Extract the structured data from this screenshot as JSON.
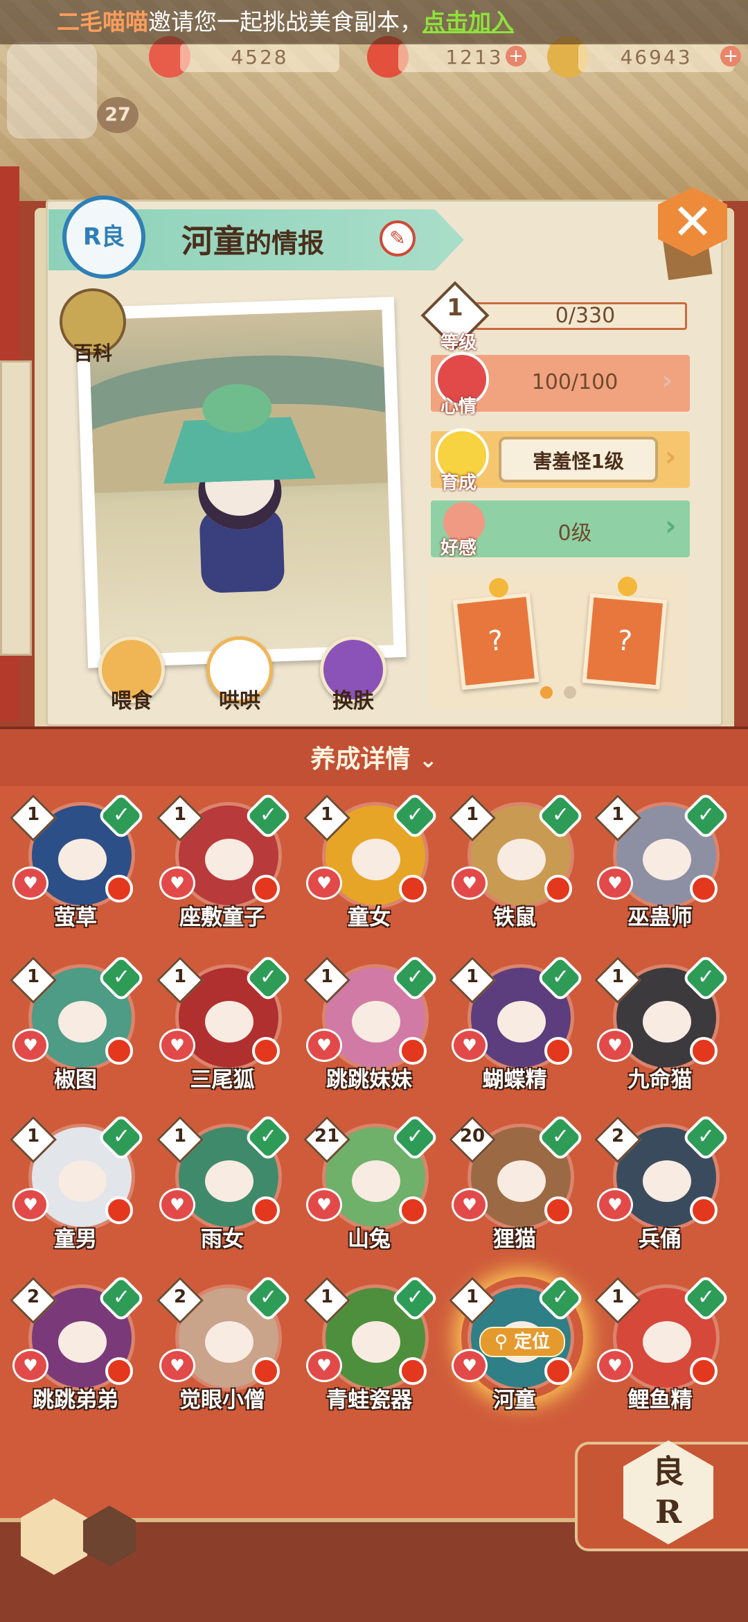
{
  "notice": {
    "inviter": "二毛喵喵",
    "message": "邀请您一起挑战美食副本，",
    "join": "点击加入"
  },
  "resources": [
    {
      "icon": "peach-blossom-icon",
      "value": "4528"
    },
    {
      "icon": "magatama-icon",
      "value": "1213"
    },
    {
      "icon": "coin-icon",
      "value": "46943"
    }
  ],
  "player_level": "27",
  "panel": {
    "rarity_badge": "R良",
    "title_name": "河童",
    "title_suffix": "的情报",
    "encyclopedia": "百科",
    "actions": [
      {
        "label": "喂食",
        "icon": "food-bowl-icon"
      },
      {
        "label": "哄哄",
        "icon": "milk-carton-icon"
      },
      {
        "label": "换肤",
        "icon": "kimono-icon"
      }
    ],
    "stats": {
      "level": {
        "num": "1",
        "label": "等级",
        "exp": "0/330"
      },
      "mood": {
        "label": "心情",
        "value": "100/100"
      },
      "growth": {
        "label": "育成",
        "value": "害羞怪1级"
      },
      "affection": {
        "label": "好感",
        "value": "0级"
      }
    },
    "card_slots": [
      {
        "icon": "locked-card-icon",
        "mark": "?"
      },
      {
        "icon": "locked-card-icon",
        "mark": "?"
      }
    ]
  },
  "details_header": "养成详情",
  "locate_label": "定位",
  "pets": [
    {
      "name": "萤草",
      "level": "1",
      "color": "#2c4f88"
    },
    {
      "name": "座敷童子",
      "level": "1",
      "color": "#b83a3a"
    },
    {
      "name": "童女",
      "level": "1",
      "color": "#e6a526"
    },
    {
      "name": "铁鼠",
      "level": "1",
      "color": "#c99a52"
    },
    {
      "name": "巫蛊师",
      "level": "1",
      "color": "#8d8fa3"
    },
    {
      "name": "椒图",
      "level": "1",
      "color": "#4e9b86"
    },
    {
      "name": "三尾狐",
      "level": "1",
      "color": "#b02f2f"
    },
    {
      "name": "跳跳妹妹",
      "level": "1",
      "color": "#d07aa5"
    },
    {
      "name": "蝴蝶精",
      "level": "1",
      "color": "#5c3e7e"
    },
    {
      "name": "九命猫",
      "level": "1",
      "color": "#3c3a3d"
    },
    {
      "name": "童男",
      "level": "1",
      "color": "#e2e5ea"
    },
    {
      "name": "雨女",
      "level": "1",
      "color": "#3f8a6b"
    },
    {
      "name": "山兔",
      "level": "21",
      "color": "#6fb06a"
    },
    {
      "name": "狸猫",
      "level": "20",
      "color": "#9b6a44"
    },
    {
      "name": "兵俑",
      "level": "2",
      "color": "#3b4b5e"
    },
    {
      "name": "跳跳弟弟",
      "level": "2",
      "color": "#7a3a7a"
    },
    {
      "name": "觉眼小僧",
      "level": "2",
      "color": "#c9a38a"
    },
    {
      "name": "青蛙瓷器",
      "level": "1",
      "color": "#4d8f3c"
    },
    {
      "name": "河童",
      "level": "1",
      "color": "#2f7f86",
      "selected": true
    },
    {
      "name": "鲤鱼精",
      "level": "1",
      "color": "#d6483a"
    }
  ],
  "sort_button": {
    "top": "良",
    "bottom": "R"
  },
  "colors": {
    "panel": "#efe5cf",
    "grid": "#cf5b3b",
    "mood_row": "#f1a27f",
    "growth_row": "#f6c66f",
    "affection_row": "#8fd1a5"
  }
}
